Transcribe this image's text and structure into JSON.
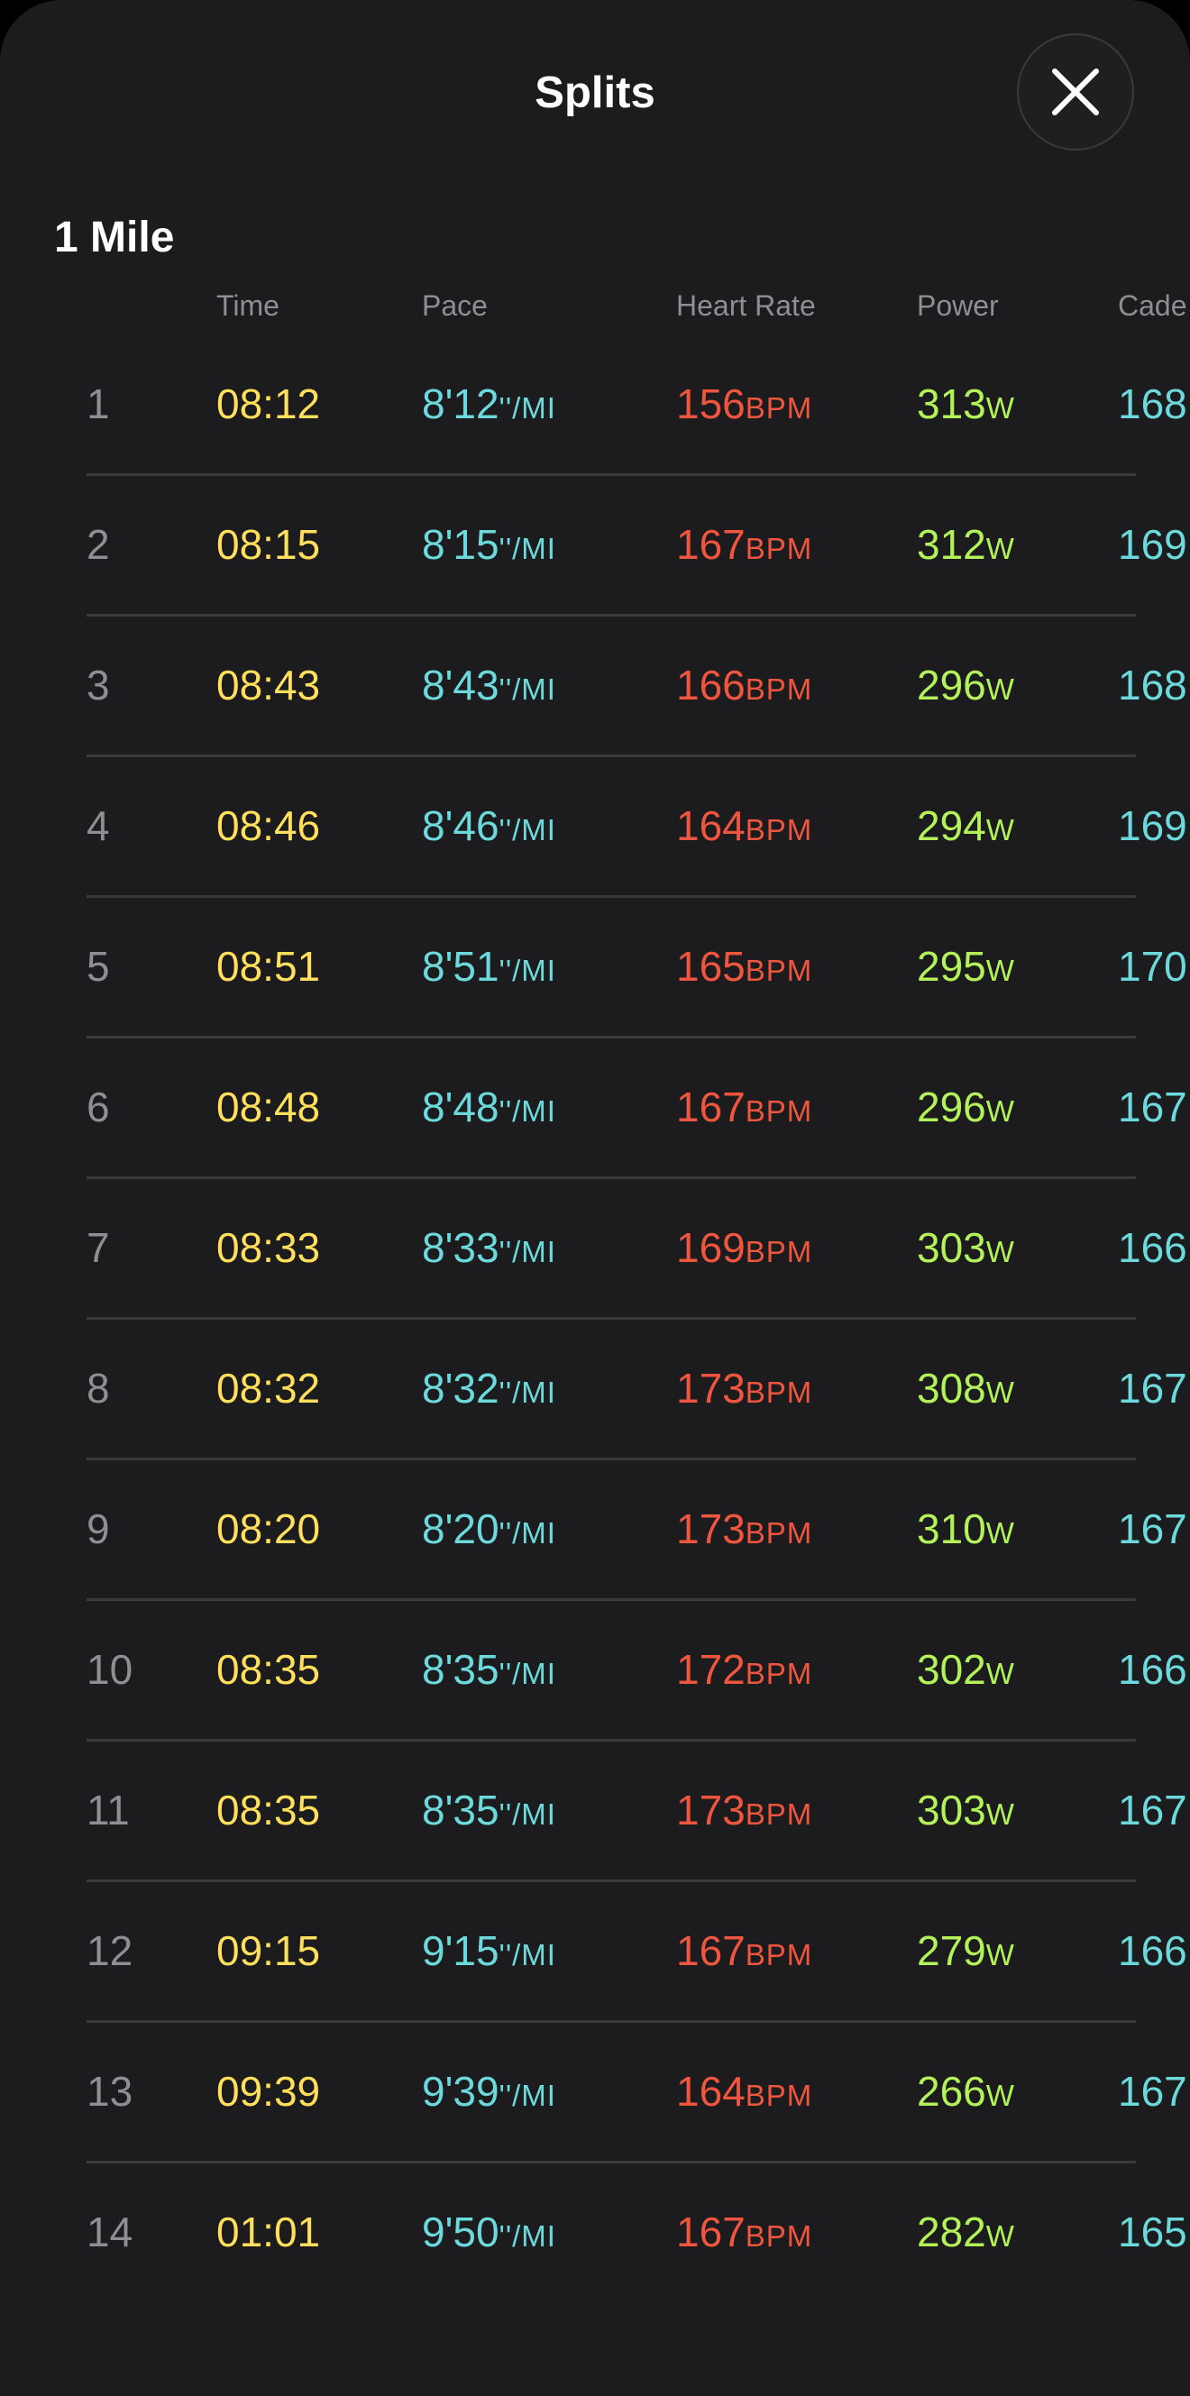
{
  "header": {
    "title": "Splits",
    "close_icon": "close-icon"
  },
  "section": {
    "title": "1 Mile"
  },
  "columns": [
    "Time",
    "Pace",
    "Heart Rate",
    "Power",
    "Cade"
  ],
  "units": {
    "pace": "''/MI",
    "heart_rate": "BPM",
    "power": "W"
  },
  "colors": {
    "background": "#1c1c1e",
    "index": "#8e8e93",
    "time": "#ffdf5c",
    "pace": "#6cdadc",
    "heart_rate": "#f0553e",
    "power": "#b4f25a",
    "cadence": "#6cdadc",
    "divider": "#3a3a3c"
  },
  "splits": [
    {
      "index": "1",
      "time": "08:12",
      "pace": "8'12",
      "heart_rate": "156",
      "power": "313",
      "cadence": "168"
    },
    {
      "index": "2",
      "time": "08:15",
      "pace": "8'15",
      "heart_rate": "167",
      "power": "312",
      "cadence": "169"
    },
    {
      "index": "3",
      "time": "08:43",
      "pace": "8'43",
      "heart_rate": "166",
      "power": "296",
      "cadence": "168"
    },
    {
      "index": "4",
      "time": "08:46",
      "pace": "8'46",
      "heart_rate": "164",
      "power": "294",
      "cadence": "169"
    },
    {
      "index": "5",
      "time": "08:51",
      "pace": "8'51",
      "heart_rate": "165",
      "power": "295",
      "cadence": "170"
    },
    {
      "index": "6",
      "time": "08:48",
      "pace": "8'48",
      "heart_rate": "167",
      "power": "296",
      "cadence": "167"
    },
    {
      "index": "7",
      "time": "08:33",
      "pace": "8'33",
      "heart_rate": "169",
      "power": "303",
      "cadence": "166"
    },
    {
      "index": "8",
      "time": "08:32",
      "pace": "8'32",
      "heart_rate": "173",
      "power": "308",
      "cadence": "167"
    },
    {
      "index": "9",
      "time": "08:20",
      "pace": "8'20",
      "heart_rate": "173",
      "power": "310",
      "cadence": "167"
    },
    {
      "index": "10",
      "time": "08:35",
      "pace": "8'35",
      "heart_rate": "172",
      "power": "302",
      "cadence": "166"
    },
    {
      "index": "11",
      "time": "08:35",
      "pace": "8'35",
      "heart_rate": "173",
      "power": "303",
      "cadence": "167"
    },
    {
      "index": "12",
      "time": "09:15",
      "pace": "9'15",
      "heart_rate": "167",
      "power": "279",
      "cadence": "166"
    },
    {
      "index": "13",
      "time": "09:39",
      "pace": "9'39",
      "heart_rate": "164",
      "power": "266",
      "cadence": "167"
    },
    {
      "index": "14",
      "time": "01:01",
      "pace": "9'50",
      "heart_rate": "167",
      "power": "282",
      "cadence": "165"
    }
  ]
}
